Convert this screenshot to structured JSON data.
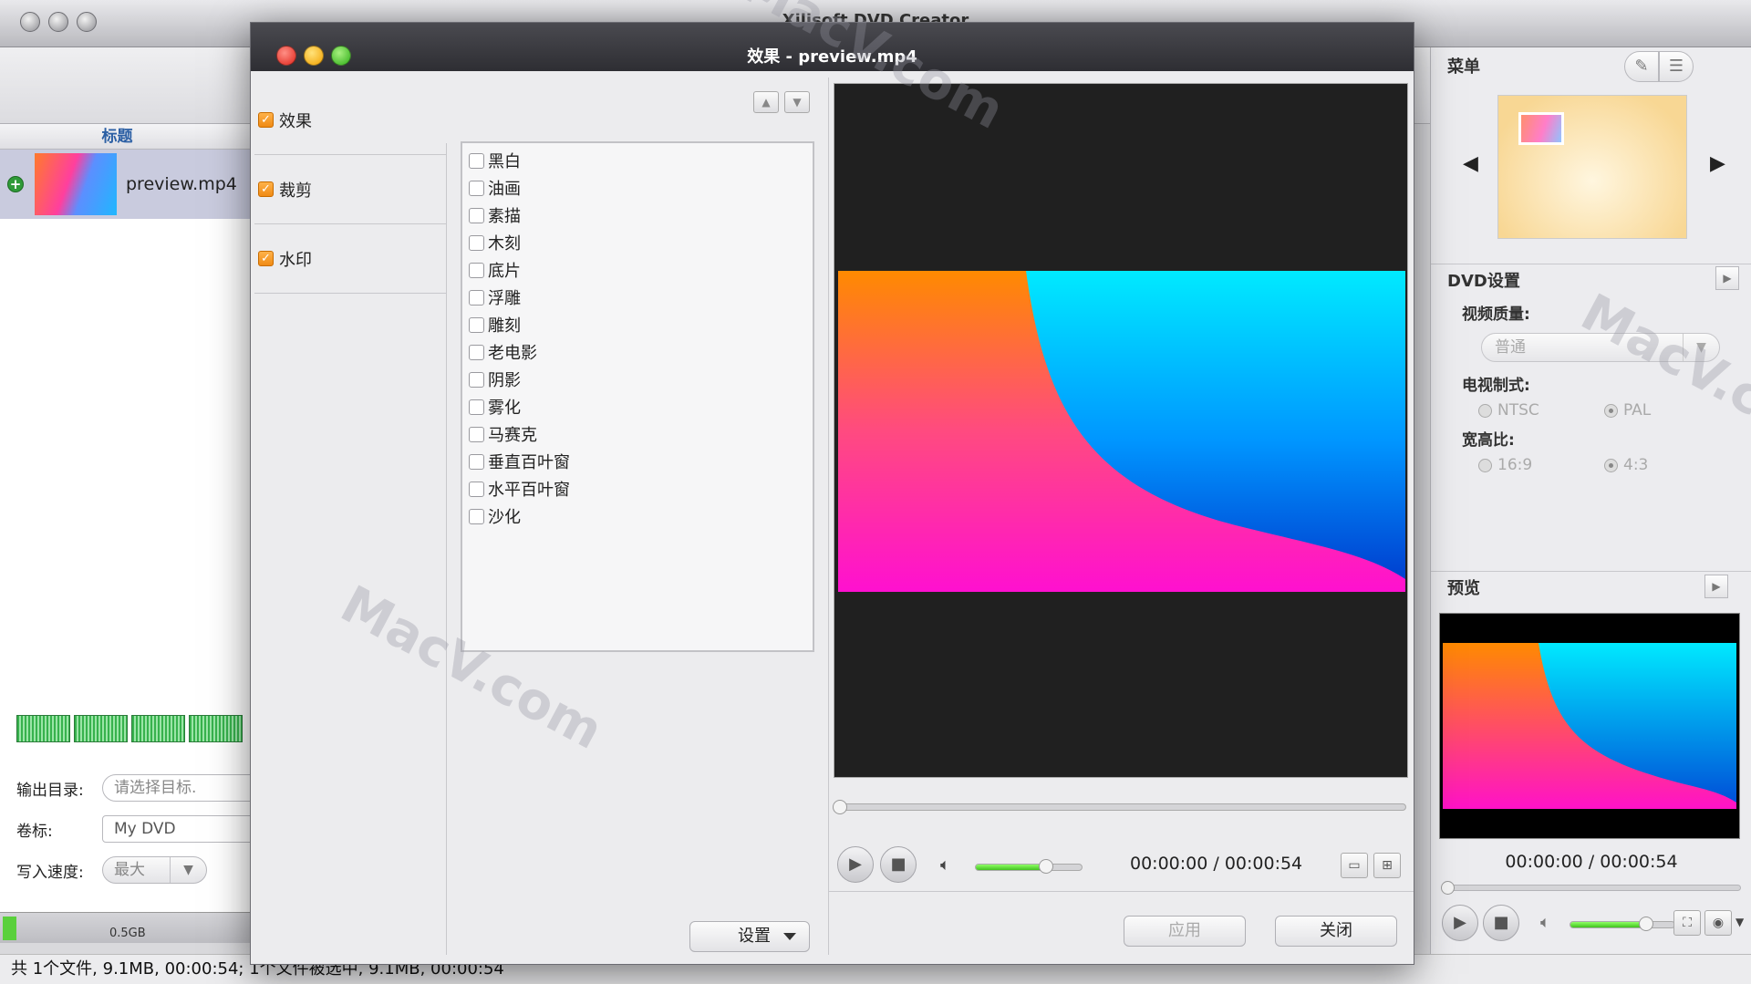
{
  "main_window": {
    "title": "Xilisoft DVD Creator",
    "title_col_header": "标题",
    "file": {
      "name": "preview.mp4"
    },
    "output_dir_label": "输出目录:",
    "output_dir_placeholder": "请选择目标.",
    "volume_label": "卷标:",
    "volume_value": "My DVD",
    "speed_label": "写入速度:",
    "speed_value": "最大",
    "capacity_label": "0.5GB",
    "status": "共 1个文件, 9.1MB, 00:00:54; 1个文件被选中, 9.1MB, 00:00:54"
  },
  "right_panel": {
    "menu_title": "菜单",
    "dvd_settings_title": "DVD设置",
    "video_quality_label": "视频质量:",
    "video_quality_value": "普通",
    "tv_standard_label": "电视制式:",
    "tv_options": [
      "NTSC",
      "PAL"
    ],
    "tv_selected": "PAL",
    "aspect_label": "宽高比:",
    "aspect_options": [
      "16:9",
      "4:3"
    ],
    "aspect_selected": "4:3",
    "preview_title": "预览",
    "time": "00:00:00 / 00:00:54",
    "volume_level": 0.75,
    "seek_position": 0
  },
  "dialog": {
    "title": "效果 - preview.mp4",
    "tabs": [
      {
        "label": "效果",
        "checked": true
      },
      {
        "label": "裁剪",
        "checked": true
      },
      {
        "label": "水印",
        "checked": true
      }
    ],
    "effects": [
      "黑白",
      "油画",
      "素描",
      "木刻",
      "底片",
      "浮雕",
      "雕刻",
      "老电影",
      "阴影",
      "雾化",
      "马赛克",
      "垂直百叶窗",
      "水平百叶窗",
      "沙化"
    ],
    "settings_label": "设置",
    "time": "00:00:00 / 00:00:54",
    "volume_level": 0.68,
    "seek_position": 0,
    "apply_label": "应用",
    "close_label": "关闭"
  },
  "watermark_text": "MacV.com",
  "colors": {
    "accent_orange": "#f08a14",
    "volume_green": "#42c21f",
    "title_blue": "#2b5fa4"
  }
}
